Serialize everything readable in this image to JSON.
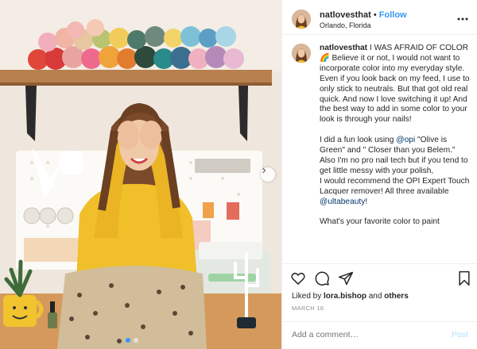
{
  "colors": {
    "accent": "#3897f0",
    "muted": "#8e8e8e",
    "text": "#262626",
    "border": "#efefef",
    "post_disabled": "#b2dffc"
  },
  "photo": {
    "carousel_index": 1,
    "carousel_total": 2
  },
  "header": {
    "username": "natlovesthat",
    "separator": "•",
    "follow_label": "Follow",
    "location": "Orlando, Florida",
    "more_icon": "more-horizontal-icon"
  },
  "caption": {
    "username": "natlovesthat",
    "line1": " I WAS AFRAID OF COLOR 🌈 Believe it or not, I would not want to incorporate color into my everyday style.",
    "line2": "Even if you look back on my feed, I use to only stick to neutrals. But that got old real quick. And now I love switching it up! And the best way to add in some color to your look is through your nails!",
    "p2_pre": "I did a fun look using ",
    "mention_opi": "@opi",
    "p2_mid": " \"Olive is Green\" and \" Closer than you Belem.\" Also I'm no pro nail tech but if you tend to get little messy with your polish,",
    "p2_line2": "I would recommend the OPI Expert Touch Lacquer remover! All three available ",
    "mention_ulta": "@ultabeauty",
    "p2_end": "!",
    "p3": "What's your favorite color to paint"
  },
  "actions": {
    "like_icon": "heart-icon",
    "comment_icon": "comment-icon",
    "share_icon": "share-icon",
    "save_icon": "bookmark-icon"
  },
  "likes": {
    "prefix": "Liked by ",
    "user": "lora.bishop",
    "middle": " and ",
    "others": "others"
  },
  "date": "MARCH 16",
  "comment": {
    "placeholder": "Add a comment…",
    "post_label": "Post"
  }
}
